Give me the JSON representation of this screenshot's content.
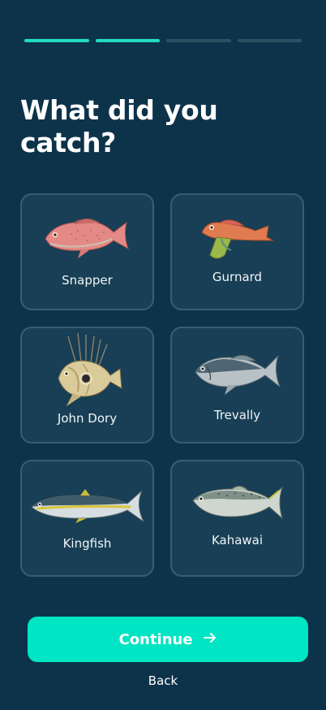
{
  "progress": {
    "total_steps": 4,
    "completed_steps": 2
  },
  "title": "What did you catch?",
  "fish_options": [
    {
      "label": "Snapper",
      "icon": "snapper-icon"
    },
    {
      "label": "Gurnard",
      "icon": "gurnard-icon"
    },
    {
      "label": "John Dory",
      "icon": "john-dory-icon"
    },
    {
      "label": "Trevally",
      "icon": "trevally-icon"
    },
    {
      "label": "Kingfish",
      "icon": "kingfish-icon"
    },
    {
      "label": "Kahawai",
      "icon": "kahawai-icon"
    }
  ],
  "actions": {
    "continue_label": "Continue",
    "continue_icon": "arrow-right-icon",
    "back_label": "Back"
  },
  "colors": {
    "background": "#0d334a",
    "accent": "#00e5c4",
    "card": "#183f55",
    "card_border": "#3b5c71"
  }
}
